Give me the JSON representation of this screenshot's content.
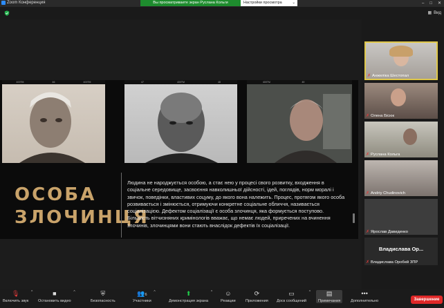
{
  "window": {
    "app_title": "Zoom Конференция",
    "controls": [
      "–",
      "□",
      "✕"
    ]
  },
  "share_bar": {
    "banner": "Вы просматриваете экран Руслана Кольги",
    "settings_label": "Настройки просмотра",
    "chevron": "⌄"
  },
  "top": {
    "view_label": "Вид",
    "shield_color": "#23b14d"
  },
  "slide": {
    "title_line1": "ОСОБА",
    "title_line2": "ЗЛОЧИНЦЯ",
    "title_color": "#c9a36a",
    "paragraph": "Людина не народжується особою, а стає нею у процесі свого розвитку, входження в соціальне середовище, засвоєння навколишньої дійсності, ідей, поглядів, норм моралі і звичок, поведінки, властивих соцуму, до якого вона належить. Процес, протягом якого особа розвивається і змінюється, отримуючи конкретне соціальне обличчя, називається соціалізацією. Дефектом соціалізації є особа злочинця, яка формується поступово. Більшість вітчизняних кримінологів вважає, що немає людей, приречених на вчинення злочинів, злочинцями вони стають внаслідок дефектів їх соціалізації.",
    "photo_bars": [
      [
        "400TM",
        "46",
        "400TM"
      ],
      [
        "47",
        "400TM",
        "48"
      ],
      [
        "400TM",
        "49",
        ""
      ]
    ]
  },
  "participants": [
    {
      "name": "Анжеліка Шестопал",
      "muted": true
    },
    {
      "name": "Олена Бісюк",
      "muted": true
    },
    {
      "name": "Руслана Кольга",
      "muted": true
    },
    {
      "name": "Andriy Chudinovich",
      "muted": true
    },
    {
      "name": "Ярослав Давиденко",
      "muted": true
    },
    {
      "name": "Владислава Ор...",
      "muted": false
    },
    {
      "name": "Владислава Оробей ЗПР",
      "muted": true
    }
  ],
  "toolbar": {
    "mute": "Включить звук",
    "video": "Остановить видео",
    "security": "Безопасность",
    "participants": "Участники",
    "participants_count": "6",
    "share": "Демонстрация экрана",
    "reactions": "Реакции",
    "apps": "Приложения",
    "whiteboard": "Доск сообщений",
    "notes": "Примечания",
    "more": "Дополнительно",
    "end": "Завершение",
    "end_color": "#e02828",
    "share_color": "#1fd14b"
  }
}
